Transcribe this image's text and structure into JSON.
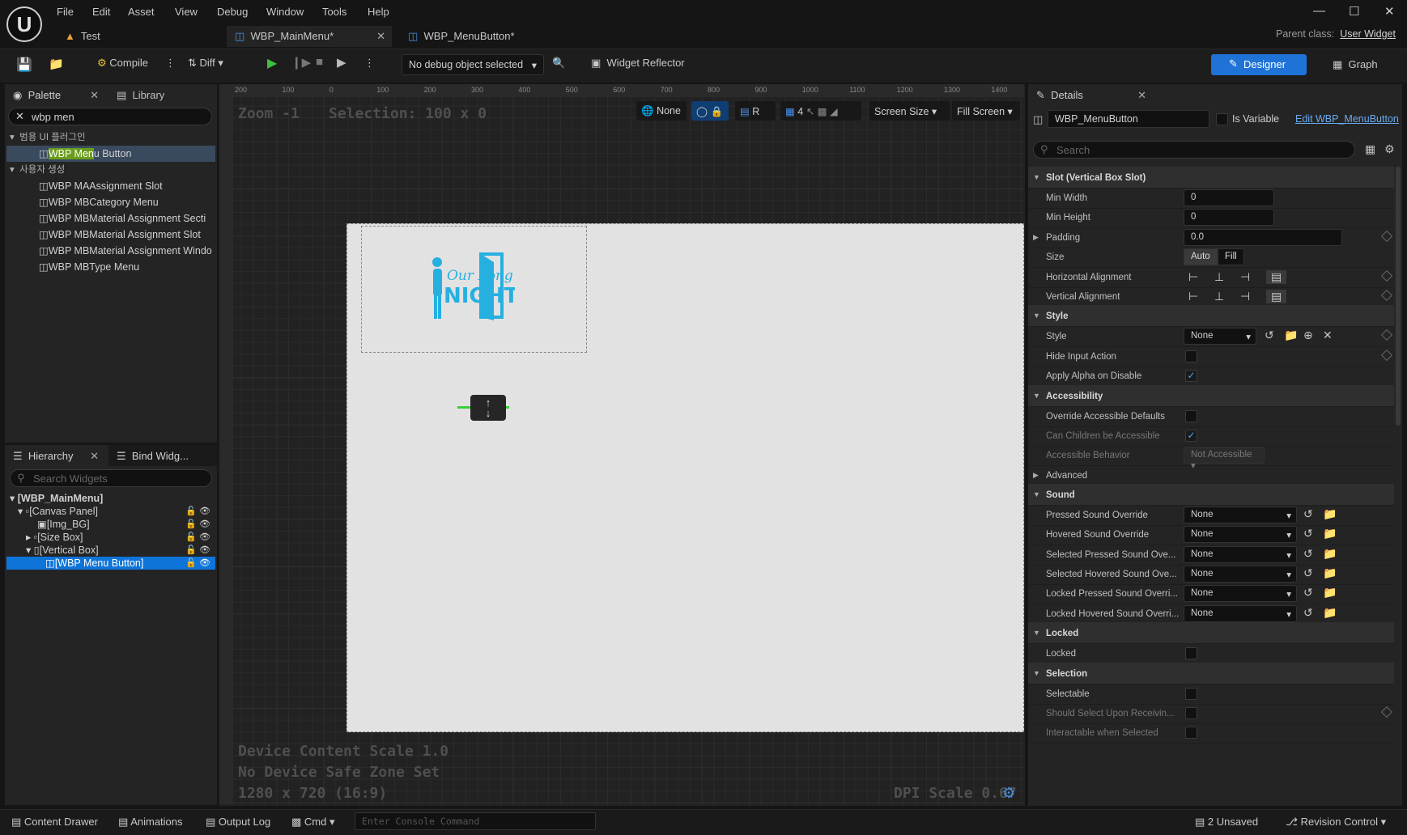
{
  "app": {
    "menu": [
      "File",
      "Edit",
      "Asset",
      "View",
      "Debug",
      "Window",
      "Tools",
      "Help"
    ],
    "tabs": [
      {
        "label": "Test"
      },
      {
        "label": "WBP_MainMenu*"
      },
      {
        "label": "WBP_MenuButton*"
      }
    ],
    "parent_class_label": "Parent class:",
    "parent_class_value": "User Widget"
  },
  "toolbar": {
    "compile": "Compile",
    "diff": "Diff",
    "debug_object": "No debug object selected",
    "widget_reflector": "Widget Reflector",
    "designer": "Designer",
    "graph": "Graph"
  },
  "palette": {
    "tab": "Palette",
    "library_tab": "Library",
    "search_value": "wbp men",
    "category1": "범용 UI 플러그인",
    "item_selected": {
      "pre": "",
      "hl": "WBP Men",
      "post": "u Button"
    },
    "category2": "사용자 생성",
    "items": [
      "WBP MAAssignment Slot",
      "WBP MBCategory Menu",
      "WBP MBMaterial Assignment Secti",
      "WBP MBMaterial Assignment Slot",
      "WBP MBMaterial Assignment Windo",
      "WBP MBType Menu"
    ]
  },
  "hierarchy": {
    "tab": "Hierarchy",
    "bind_tab": "Bind Widg...",
    "search_placeholder": "Search Widgets",
    "rows": [
      "[WBP_MainMenu]",
      "[Canvas Panel]",
      "[Img_BG]",
      "[Size Box]",
      "[Vertical Box]",
      "[WBP Menu Button]"
    ]
  },
  "viewport": {
    "zoom": "Zoom -1",
    "selection": "Selection: 100 x 0",
    "none_label": "None",
    "r_label": "R",
    "grid_count": "4",
    "screen_size": "Screen Size",
    "fill_screen": "Fill Screen",
    "device_scale": "Device Content Scale 1.0",
    "safe_zone": "No Device Safe Zone Set",
    "resolution": "1280 x 720 (16:9)",
    "dpi_scale": "DPI Scale 0.67",
    "ruler_top": [
      "200",
      "100",
      "0",
      "100",
      "200",
      "300",
      "400",
      "500",
      "600",
      "700",
      "800",
      "900",
      "1000",
      "1100",
      "1200",
      "1300",
      "1400"
    ],
    "logo_text1": "Our Long",
    "logo_text2": "NIGHT"
  },
  "details": {
    "tab": "Details",
    "widget_name": "WBP_MenuButton",
    "is_variable": "Is Variable",
    "edit_link": "Edit WBP_MenuButton",
    "search_placeholder": "Search",
    "rows": [
      {
        "type": "section",
        "label": "Slot (Vertical Box Slot)"
      },
      {
        "type": "input",
        "label": "Min Width",
        "value": "0"
      },
      {
        "type": "input",
        "label": "Min Height",
        "value": "0"
      },
      {
        "type": "input-wide",
        "label": "Padding",
        "value": "0.0",
        "expander": true
      },
      {
        "type": "toggle",
        "label": "Size",
        "value": "Auto",
        "alt": "Fill"
      },
      {
        "type": "align",
        "label": "Horizontal Alignment"
      },
      {
        "type": "align",
        "label": "Vertical Alignment"
      },
      {
        "type": "section",
        "label": "Style"
      },
      {
        "type": "style",
        "label": "Style",
        "value": "None"
      },
      {
        "type": "check",
        "label": "Hide Input Action",
        "checked": false
      },
      {
        "type": "check",
        "label": "Apply Alpha on Disable",
        "checked": true
      },
      {
        "type": "section",
        "label": "Accessibility"
      },
      {
        "type": "check",
        "label": "Override Accessible Defaults",
        "checked": false
      },
      {
        "type": "check",
        "label": "Can Children be Accessible",
        "checked": true,
        "dim": true
      },
      {
        "type": "dropdown-small",
        "label": "Accessible Behavior",
        "value": "Not Accessible",
        "dim": true
      },
      {
        "type": "sub",
        "label": "Advanced"
      },
      {
        "type": "section",
        "label": "Sound"
      },
      {
        "type": "sound",
        "label": "Pressed Sound Override",
        "value": "None"
      },
      {
        "type": "sound",
        "label": "Hovered Sound Override",
        "value": "None"
      },
      {
        "type": "sound",
        "label": "Selected Pressed Sound Ove...",
        "value": "None"
      },
      {
        "type": "sound",
        "label": "Selected Hovered Sound Ove...",
        "value": "None"
      },
      {
        "type": "sound",
        "label": "Locked Pressed Sound Overri...",
        "value": "None"
      },
      {
        "type": "sound",
        "label": "Locked Hovered Sound Overri...",
        "value": "None"
      },
      {
        "type": "section",
        "label": "Locked"
      },
      {
        "type": "check",
        "label": "Locked",
        "checked": false
      },
      {
        "type": "section",
        "label": "Selection"
      },
      {
        "type": "check",
        "label": "Selectable",
        "checked": false
      },
      {
        "type": "check",
        "label": "Should Select Upon Receivin...",
        "checked": false,
        "dim": true
      },
      {
        "type": "check",
        "label": "Interactable when Selected",
        "checked": false,
        "dim": true
      }
    ]
  },
  "statusbar": {
    "content_drawer": "Content Drawer",
    "animations": "Animations",
    "output_log": "Output Log",
    "cmd": "Cmd",
    "console_placeholder": "Enter Console Command",
    "unsaved": "2 Unsaved",
    "revision": "Revision Control"
  },
  "colors": {
    "accent": "#1f73d6",
    "selection": "#0f74d9",
    "highlight": "#6a9d1a",
    "logo": "#26b0e0"
  }
}
